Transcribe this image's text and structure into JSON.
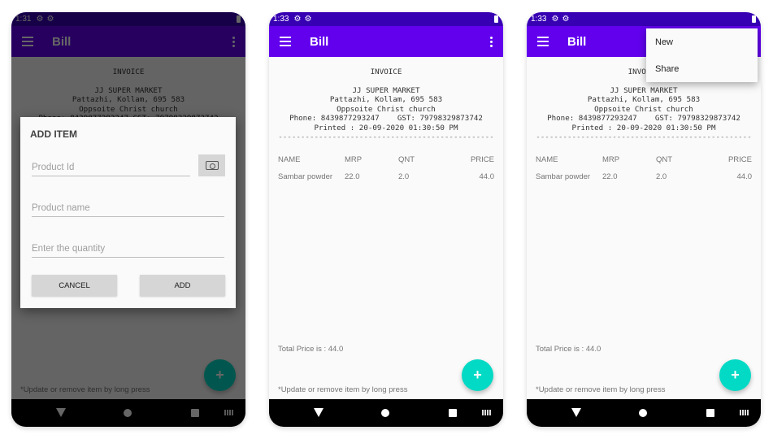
{
  "status": {
    "time_1": "1:31",
    "time_2": "1:33",
    "time_3": "1:33",
    "gear": "⚙"
  },
  "app_bar": {
    "title": "Bill"
  },
  "invoice": {
    "title": "INVOICE",
    "shop_name": "JJ SUPER MARKET",
    "address_1": "Pattazhi, Kollam, 695 583",
    "address_2": "Oppsoite Christ church",
    "phone_gst": "Phone: 8439877293247    GST: 79798329873742",
    "printed": "Printed : 20-09-2020 01:30:50 PM",
    "separator": "------------------------------------------------"
  },
  "table": {
    "headers": [
      "NAME",
      "MRP",
      "QNT",
      "PRICE"
    ],
    "rows": [
      [
        "Sambar powder",
        "22.0",
        "2.0",
        "44.0"
      ]
    ]
  },
  "total_text": "Total Price is : 44.0",
  "note_text": "*Update or remove item by long press",
  "fab_label": "+",
  "dialog": {
    "title": "ADD ITEM",
    "product_id_placeholder": "Product Id",
    "product_name_placeholder": "Product name",
    "quantity_placeholder": "Enter the quantity",
    "cancel_label": "CANCEL",
    "add_label": "ADD"
  },
  "overflow_menu": {
    "items": [
      "New",
      "Share"
    ]
  }
}
